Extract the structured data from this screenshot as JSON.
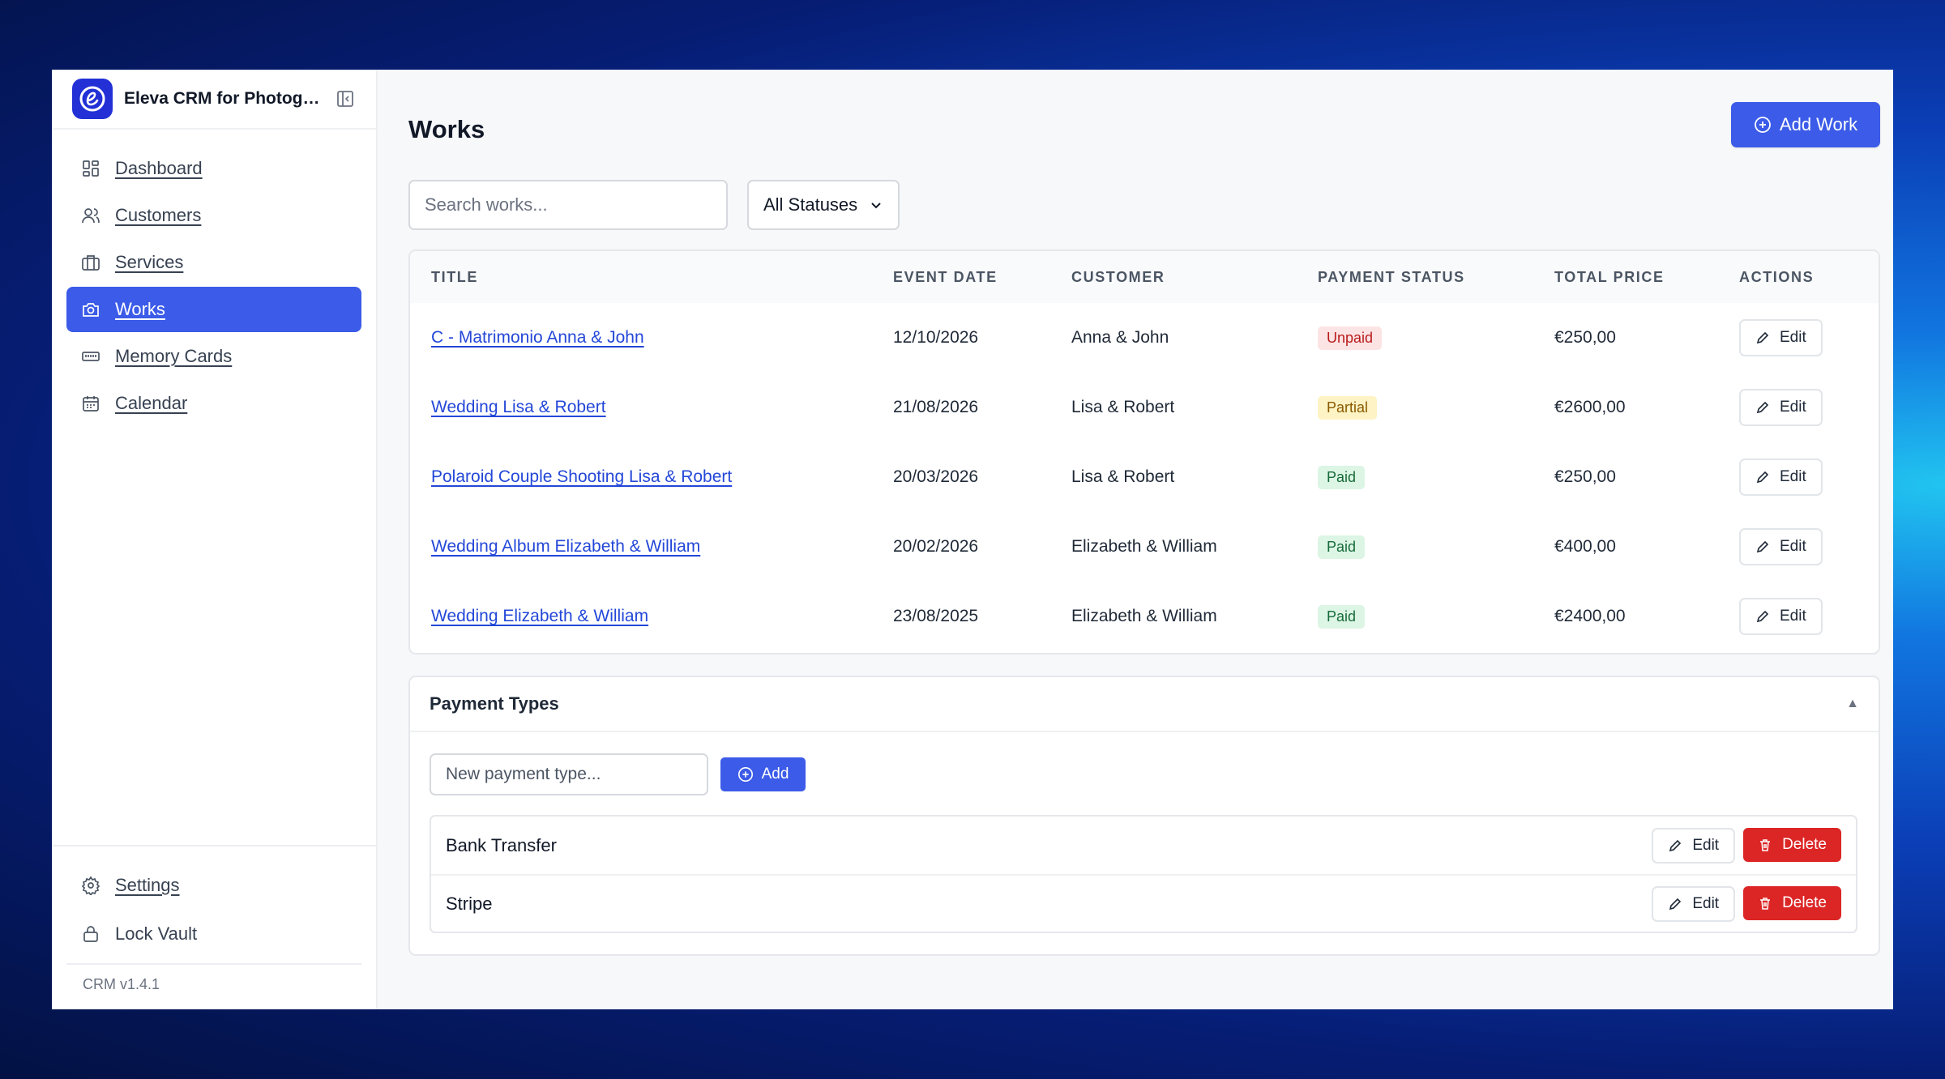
{
  "app": {
    "name": "Eleva CRM for Photographers",
    "version": "CRM v1.4.1"
  },
  "colors": {
    "accent": "#3b5be8",
    "danger": "#dc2626",
    "logo": "#2230d6"
  },
  "sidebar": {
    "items": [
      {
        "label": "Dashboard",
        "icon": "dashboard-icon"
      },
      {
        "label": "Customers",
        "icon": "users-icon"
      },
      {
        "label": "Services",
        "icon": "briefcase-icon"
      },
      {
        "label": "Works",
        "icon": "camera-icon",
        "active": true
      },
      {
        "label": "Memory Cards",
        "icon": "memory-card-icon"
      },
      {
        "label": "Calendar",
        "icon": "calendar-icon"
      }
    ],
    "settings_label": "Settings",
    "lock_label": "Lock Vault"
  },
  "page": {
    "title": "Works",
    "add_label": "Add Work",
    "search_placeholder": "Search works...",
    "status_filter": "All Statuses"
  },
  "table": {
    "columns": [
      "TITLE",
      "EVENT DATE",
      "CUSTOMER",
      "PAYMENT STATUS",
      "TOTAL PRICE",
      "ACTIONS"
    ],
    "edit_label": "Edit",
    "rows": [
      {
        "title": "C - Matrimonio Anna & John",
        "date": "12/10/2026",
        "customer": "Anna & John",
        "status": "Unpaid",
        "price": "€250,00"
      },
      {
        "title": "Wedding Lisa & Robert",
        "date": "21/08/2026",
        "customer": "Lisa & Robert",
        "status": "Partial",
        "price": "€2600,00"
      },
      {
        "title": "Polaroid Couple Shooting Lisa & Robert",
        "date": "20/03/2026",
        "customer": "Lisa & Robert",
        "status": "Paid",
        "price": "€250,00"
      },
      {
        "title": "Wedding Album Elizabeth & William",
        "date": "20/02/2026",
        "customer": "Elizabeth & William",
        "status": "Paid",
        "price": "€400,00"
      },
      {
        "title": "Wedding Elizabeth & William",
        "date": "23/08/2025",
        "customer": "Elizabeth & William",
        "status": "Paid",
        "price": "€2400,00"
      }
    ]
  },
  "payment_types": {
    "title": "Payment Types",
    "toggle": "▲",
    "new_placeholder": "New payment type...",
    "add_label": "Add",
    "edit_label": "Edit",
    "delete_label": "Delete",
    "items": [
      "Bank Transfer",
      "Stripe"
    ]
  }
}
